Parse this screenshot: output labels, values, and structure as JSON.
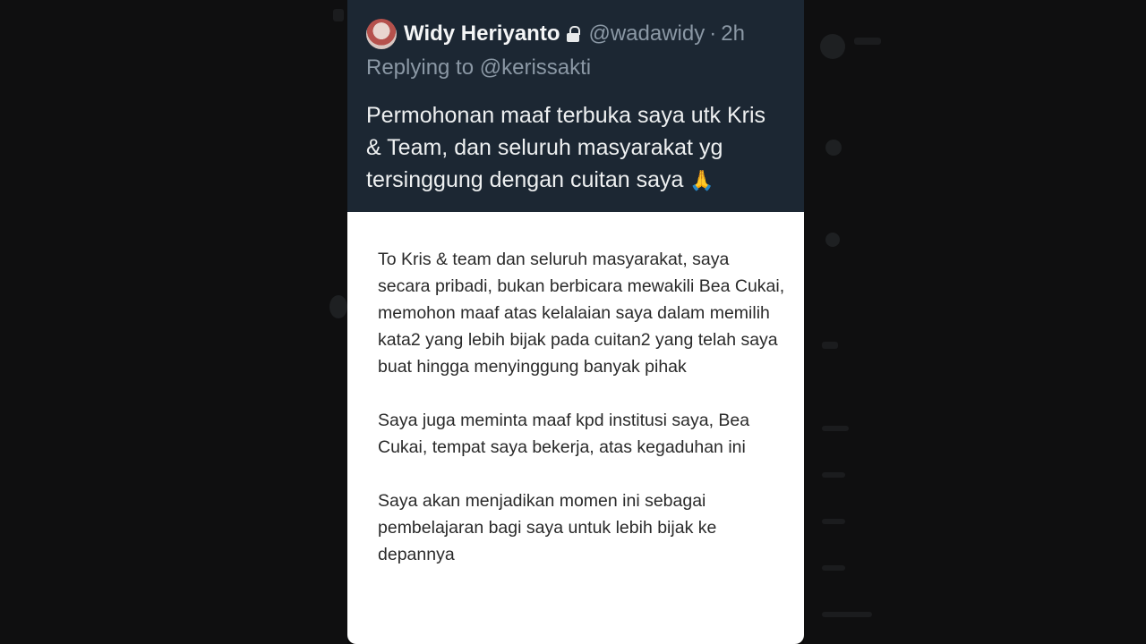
{
  "tweet": {
    "author_name": "Widy Heriyanto",
    "handle": "@wadawidy",
    "separator": "·",
    "time": "2h",
    "replying_prefix": "Replying to ",
    "replying_to": "@kerissakti",
    "text": "Permohonan maaf terbuka saya utk Kris & Team, dan seluruh masyarakat yg tersinggung dengan cuitan saya",
    "emoji": "🙏"
  },
  "letter": {
    "paragraphs": [
      "To Kris & team dan seluruh masyarakat, saya secara pribadi, bukan berbicara mewakili Bea Cukai, memohon maaf atas kelalaian saya dalam memilih kata2 yang lebih bijak pada cuitan2 yang telah saya buat hingga menyinggung banyak pihak",
      "Saya juga meminta maaf kpd institusi saya, Bea Cukai, tempat saya bekerja, atas kegaduhan ini",
      "Saya akan menjadikan momen ini sebagai pembelajaran bagi saya untuk lebih bijak ke depannya"
    ]
  },
  "icons": {
    "lock": "lock-icon",
    "avatar": "avatar"
  },
  "colors": {
    "tweet_bg": "#1c2733",
    "muted_text": "#8b98a5",
    "letter_bg": "#ffffff"
  }
}
